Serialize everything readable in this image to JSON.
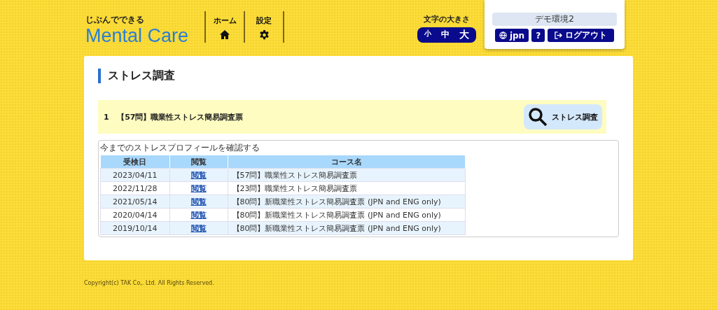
{
  "header": {
    "logo_sub": "じぶんでできる",
    "logo_main": "Mental Care",
    "nav": [
      {
        "label": "ホーム",
        "kind": "home"
      },
      {
        "label": "設定",
        "kind": "settings"
      }
    ],
    "font_size": {
      "label": "文字の大きさ",
      "options": [
        "小",
        "中",
        "大"
      ]
    },
    "user": {
      "environment": "デモ環境2",
      "language": "jpn",
      "help": "?",
      "logout": "ログアウト"
    }
  },
  "page_title": "ストレス調査",
  "survey": {
    "number": "1",
    "name": "【57問】職業性ストレス簡易調査票",
    "button": "ストレス調査"
  },
  "history": {
    "caption": "今までのストレスプロフィールを確認する",
    "columns": [
      "受検日",
      "閲覧",
      "コース名"
    ],
    "rows": [
      {
        "date": "2023/04/11",
        "view": "閲覧",
        "course": "【57問】職業性ストレス簡易調査票"
      },
      {
        "date": "2022/11/28",
        "view": "閲覧",
        "course": "【23問】職業性ストレス簡易調査票"
      },
      {
        "date": "2021/05/14",
        "view": "閲覧",
        "course": "【80問】新職業性ストレス簡易調査票 (JPN and ENG only)"
      },
      {
        "date": "2020/04/14",
        "view": "閲覧",
        "course": "【80問】新職業性ストレス簡易調査票 (JPN and ENG only)"
      },
      {
        "date": "2019/10/14",
        "view": "閲覧",
        "course": "【80問】新職業性ストレス簡易調査票 (JPN and ENG only)"
      }
    ]
  },
  "footer": "Copyright(c) TAK Co,. Ltd. All Rights Reserved."
}
